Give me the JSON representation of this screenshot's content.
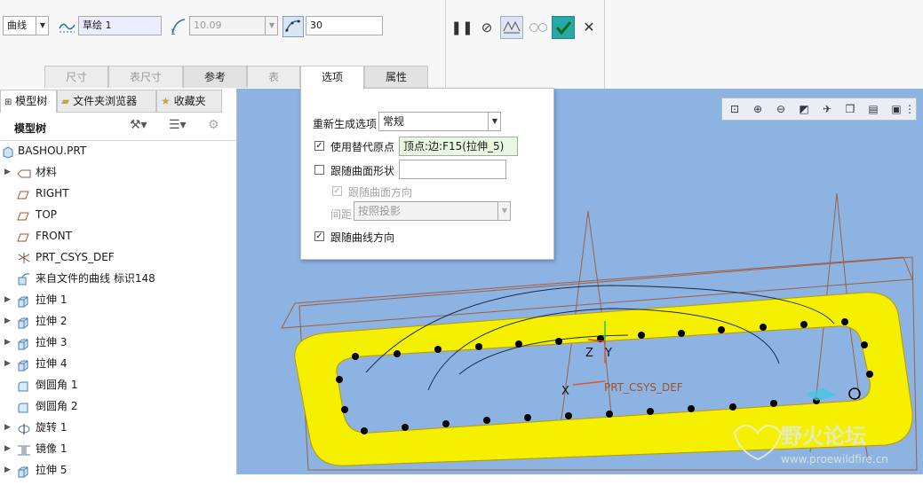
{
  "ribbon": {
    "curve_type": "曲线",
    "sketch_name": "草绘 1",
    "length_value": "10.09",
    "count_value": "30",
    "tabs": [
      {
        "label": "尺寸",
        "state": "disabled"
      },
      {
        "label": "表尺寸",
        "state": "disabled"
      },
      {
        "label": "参考",
        "state": "active"
      },
      {
        "label": "表",
        "state": "disabled"
      },
      {
        "label": "选项",
        "state": "open"
      },
      {
        "label": "属性",
        "state": "active"
      }
    ]
  },
  "tree": {
    "tabs": [
      "模型树",
      "文件夹浏览器",
      "收藏夹"
    ],
    "header": "模型树",
    "items": [
      {
        "label": "BASHOU.PRT",
        "icon": "part-icon",
        "expand": ""
      },
      {
        "label": "材料",
        "icon": "material-icon",
        "expand": "▶"
      },
      {
        "label": "RIGHT",
        "icon": "datum-plane-icon",
        "expand": ""
      },
      {
        "label": "TOP",
        "icon": "datum-plane-icon",
        "expand": ""
      },
      {
        "label": "FRONT",
        "icon": "datum-plane-icon",
        "expand": ""
      },
      {
        "label": "PRT_CSYS_DEF",
        "icon": "csys-icon",
        "expand": ""
      },
      {
        "label": "来自文件的曲线 标识148",
        "icon": "curve-file-icon",
        "expand": ""
      },
      {
        "label": "拉伸 1",
        "icon": "extrude-icon",
        "expand": "▶"
      },
      {
        "label": "拉伸 2",
        "icon": "extrude-icon",
        "expand": "▶"
      },
      {
        "label": "拉伸 3",
        "icon": "extrude-icon",
        "expand": "▶"
      },
      {
        "label": "拉伸 4",
        "icon": "extrude-icon",
        "expand": "▶"
      },
      {
        "label": "倒圆角 1",
        "icon": "round-icon",
        "expand": ""
      },
      {
        "label": "倒圆角 2",
        "icon": "round-icon",
        "expand": ""
      },
      {
        "label": "旋转 1",
        "icon": "revolve-icon",
        "expand": "▶"
      },
      {
        "label": "镜像 1",
        "icon": "mirror-icon",
        "expand": "▶"
      },
      {
        "label": "拉伸 5",
        "icon": "extrude-icon",
        "expand": "▶"
      }
    ]
  },
  "options": {
    "regen_label": "重新生成选项",
    "regen_value": "常规",
    "use_alt_origin_label": "使用替代原点",
    "use_alt_origin_checked": true,
    "alt_origin_value": "顶点:边:F15(拉伸_5)",
    "follow_surface_shape_label": "跟随曲面形状",
    "follow_surface_shape_checked": false,
    "follow_surface_dir_label": "跟随曲面方向",
    "follow_surface_dir_checked": true,
    "spacing_label": "间距",
    "spacing_value": "按照投影",
    "follow_curve_dir_label": "跟随曲线方向",
    "follow_curve_dir_checked": true
  },
  "graphics": {
    "csys_name": "PRT_CSYS_DEF",
    "axis_x": "X",
    "axis_y": "Y",
    "axis_z": "Z",
    "watermark_cn": "野火论坛",
    "watermark_url": "www.proewildfire.cn",
    "colors": {
      "background": "#8cb3e2",
      "part": "#f5f000",
      "points": "#000000",
      "datum": "#a0522d"
    }
  }
}
